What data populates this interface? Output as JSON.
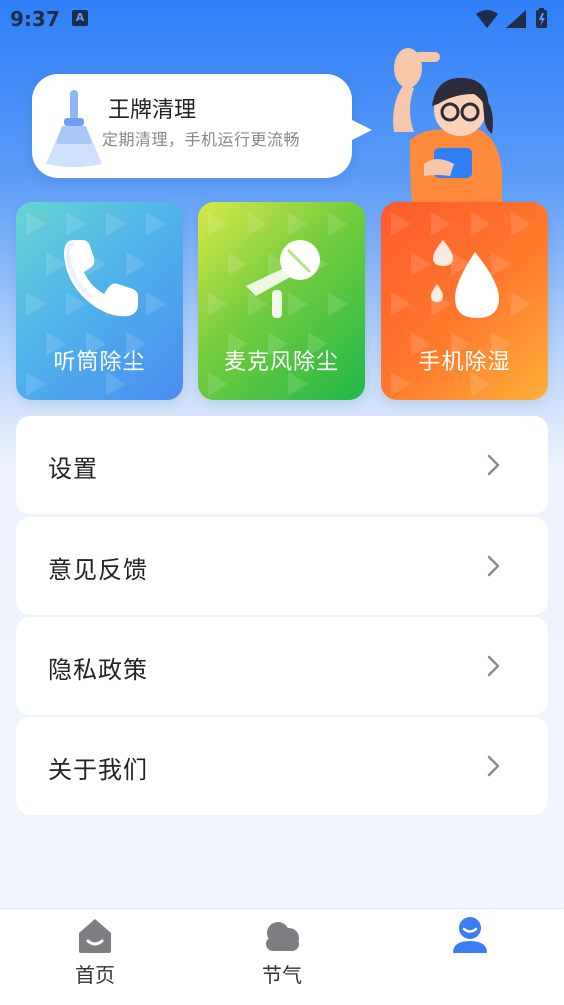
{
  "status_bar": {
    "time": "9:37",
    "notification_letter": "A"
  },
  "promo": {
    "title": "王牌清理",
    "subtitle": "定期清理，手机运行更流畅"
  },
  "feature_cards": [
    {
      "label": "听筒除尘",
      "icon": "phone-handset-icon"
    },
    {
      "label": "麦克风除尘",
      "icon": "microphone-icon"
    },
    {
      "label": "手机除湿",
      "icon": "water-drop-icon"
    }
  ],
  "menu": [
    {
      "label": "设置"
    },
    {
      "label": "意见反馈"
    },
    {
      "label": "隐私政策"
    },
    {
      "label": "关于我们"
    }
  ],
  "bottom_nav": [
    {
      "label": "首页",
      "icon": "home-icon",
      "active": false
    },
    {
      "label": "节气",
      "icon": "cloud-icon",
      "active": false
    },
    {
      "label": "",
      "icon": "user-icon",
      "active": true
    }
  ],
  "colors": {
    "accent": "#2f7ff7",
    "nav_active": "#3a7cf2",
    "nav_inactive": "#7d7d82"
  }
}
